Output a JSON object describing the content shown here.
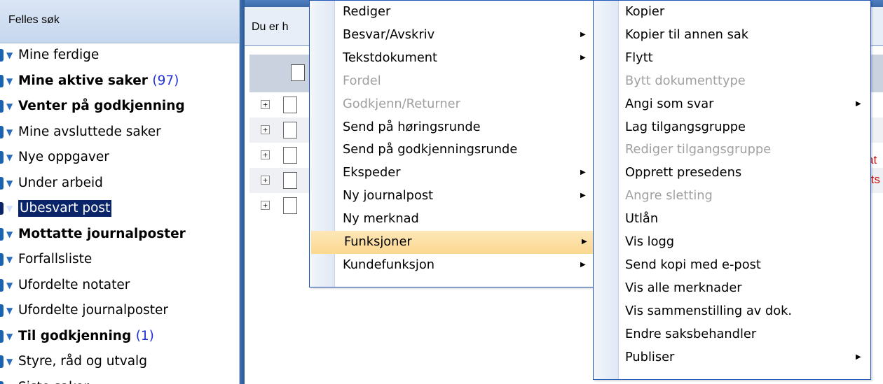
{
  "sidebar": {
    "title": "Felles søk",
    "items": [
      {
        "label": "Mine ferdige",
        "bold": false
      },
      {
        "label": "Mine aktive saker",
        "count": "(97)",
        "bold": true
      },
      {
        "label": "Venter på godkjenning",
        "bold": true
      },
      {
        "label": "Mine avsluttede saker",
        "bold": false
      },
      {
        "label": "Nye oppgaver",
        "bold": false
      },
      {
        "label": "Under arbeid",
        "bold": false
      },
      {
        "label": "Ubesvart post",
        "bold": false,
        "selected": true
      },
      {
        "label": "Mottatte journalposter",
        "bold": true
      },
      {
        "label": "Forfallsliste",
        "bold": false
      },
      {
        "label": "Ufordelte notater",
        "bold": false
      },
      {
        "label": "Ufordelte journalposter",
        "bold": false
      },
      {
        "label": "Til godkjenning",
        "count": "(1)",
        "bold": true
      },
      {
        "label": "Styre, råd og utvalg",
        "bold": false
      },
      {
        "label": "Siste saker",
        "bold": false
      }
    ]
  },
  "main": {
    "breadcrumb": "Du er h",
    "row_expand_symbol": "+",
    "red_fragments": [
      "at",
      "rts"
    ]
  },
  "menu_main": {
    "items": [
      {
        "label": "Rediger",
        "disabled": false,
        "submenu": false
      },
      {
        "label": "Besvar/Avskriv",
        "disabled": false,
        "submenu": true
      },
      {
        "label": "Tekstdokument",
        "disabled": false,
        "submenu": true
      },
      {
        "label": "Fordel",
        "disabled": true,
        "submenu": false
      },
      {
        "label": "Godkjenn/Returner",
        "disabled": true,
        "submenu": false
      },
      {
        "label": "Send på høringsrunde",
        "disabled": false,
        "submenu": false
      },
      {
        "label": "Send på godkjenningsrunde",
        "disabled": false,
        "submenu": false
      },
      {
        "label": "Ekspeder",
        "disabled": false,
        "submenu": true
      },
      {
        "label": "Ny journalpost",
        "disabled": false,
        "submenu": true
      },
      {
        "label": "Ny merknad",
        "disabled": false,
        "submenu": false
      },
      {
        "label": "Funksjoner",
        "disabled": false,
        "submenu": true,
        "highlight": true
      },
      {
        "label": "Kundefunksjon",
        "disabled": false,
        "submenu": true
      }
    ]
  },
  "menu_functions": {
    "items": [
      {
        "label": "Kopier",
        "disabled": false,
        "submenu": false
      },
      {
        "label": "Kopier til annen sak",
        "disabled": false,
        "submenu": false
      },
      {
        "label": "Flytt",
        "disabled": false,
        "submenu": false
      },
      {
        "label": "Bytt dokumenttype",
        "disabled": true,
        "submenu": false
      },
      {
        "label": "Angi som svar",
        "disabled": false,
        "submenu": true
      },
      {
        "label": "Lag tilgangsgruppe",
        "disabled": false,
        "submenu": false
      },
      {
        "label": "Rediger tilgangsgruppe",
        "disabled": true,
        "submenu": false
      },
      {
        "label": "Opprett presedens",
        "disabled": false,
        "submenu": false
      },
      {
        "label": "Angre sletting",
        "disabled": true,
        "submenu": false
      },
      {
        "label": "Utlån",
        "disabled": false,
        "submenu": false
      },
      {
        "label": "Vis logg",
        "disabled": false,
        "submenu": false
      },
      {
        "label": "Send kopi med e-post",
        "disabled": false,
        "submenu": false
      },
      {
        "label": "Vis alle merknader",
        "disabled": false,
        "submenu": false
      },
      {
        "label": "Vis sammenstilling av dok.",
        "disabled": false,
        "submenu": false
      },
      {
        "label": "Endre saksbehandler",
        "disabled": false,
        "submenu": false
      },
      {
        "label": "Publiser",
        "disabled": false,
        "submenu": true
      }
    ]
  },
  "colors": {
    "accent_blue": "#1f55b3",
    "selected_bg": "#0a246a",
    "highlight_bg": "#fbd890",
    "count_blue": "#2030d8",
    "alert_red": "#d21010",
    "disabled_text": "#a0a0a0"
  }
}
